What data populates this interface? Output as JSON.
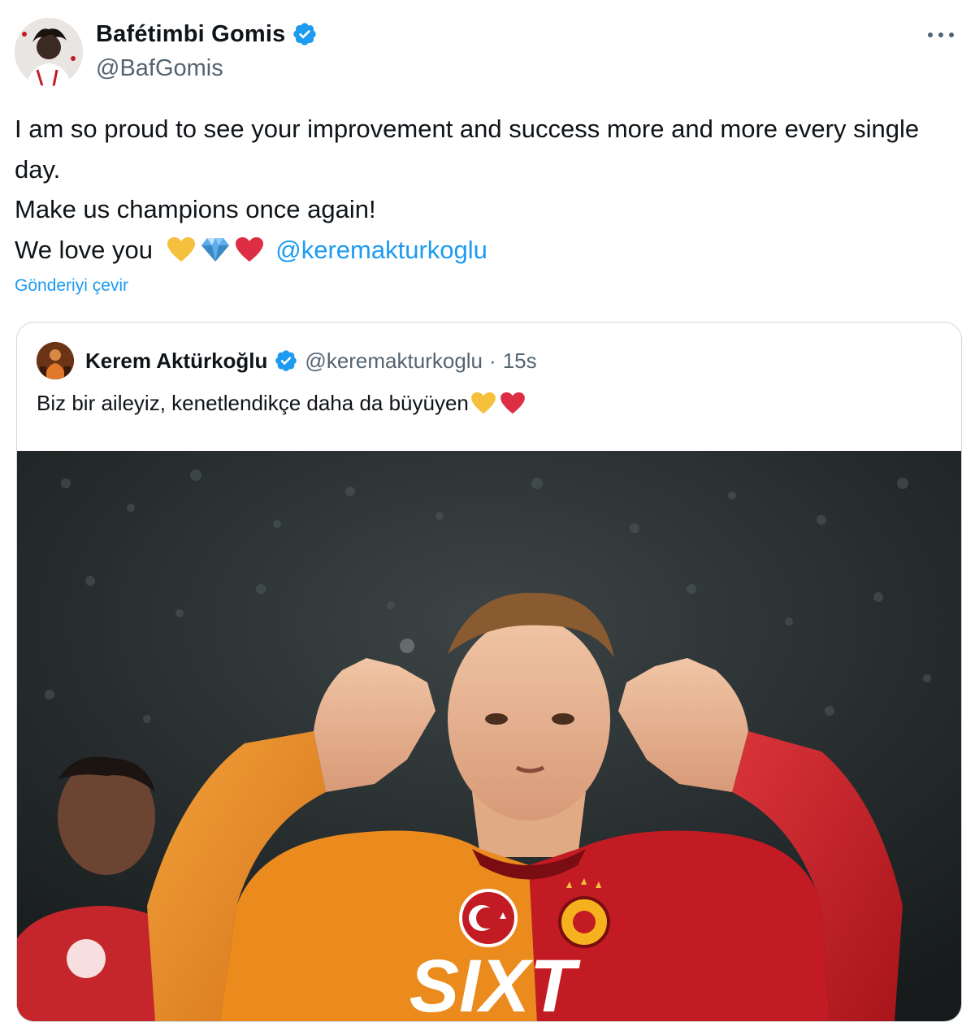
{
  "tweet": {
    "author_name": "Bafétimbi Gomis",
    "author_handle": "@BafGomis",
    "verified_icon": "verified-badge-icon",
    "more_icon": "more-options-icon",
    "lines": [
      "I am so proud to see your improvement and success more and more every single day.",
      "Make us champions once again!",
      "We love you"
    ],
    "emojis": [
      "yellow-heart-icon",
      "gem-icon",
      "red-heart-icon"
    ],
    "mention": "@keremakturkoglu",
    "translate_label": "Gönderiyi çevir"
  },
  "quote": {
    "author_name": "Kerem Aktürkoğlu",
    "author_handle": "@keremakturkoglu",
    "separator": "·",
    "time": "15s",
    "text": "Biz bir aileyiz, kenetlendikçe daha da büyüyen",
    "emojis": [
      "yellow-heart-icon",
      "red-heart-icon"
    ],
    "media": {
      "type": "photo",
      "shirt_text": "SIXT"
    }
  },
  "colors": {
    "link": "#1d9bf0",
    "text": "#0f1419",
    "secondary": "#536471",
    "border": "#cfd9de",
    "verified": "#1d9bf0",
    "yellow_heart": "#f5c13c",
    "red_heart": "#dd2e44",
    "gem": "#5dadec",
    "jersey_orange": "#e98a1d",
    "jersey_red": "#c21b23"
  }
}
